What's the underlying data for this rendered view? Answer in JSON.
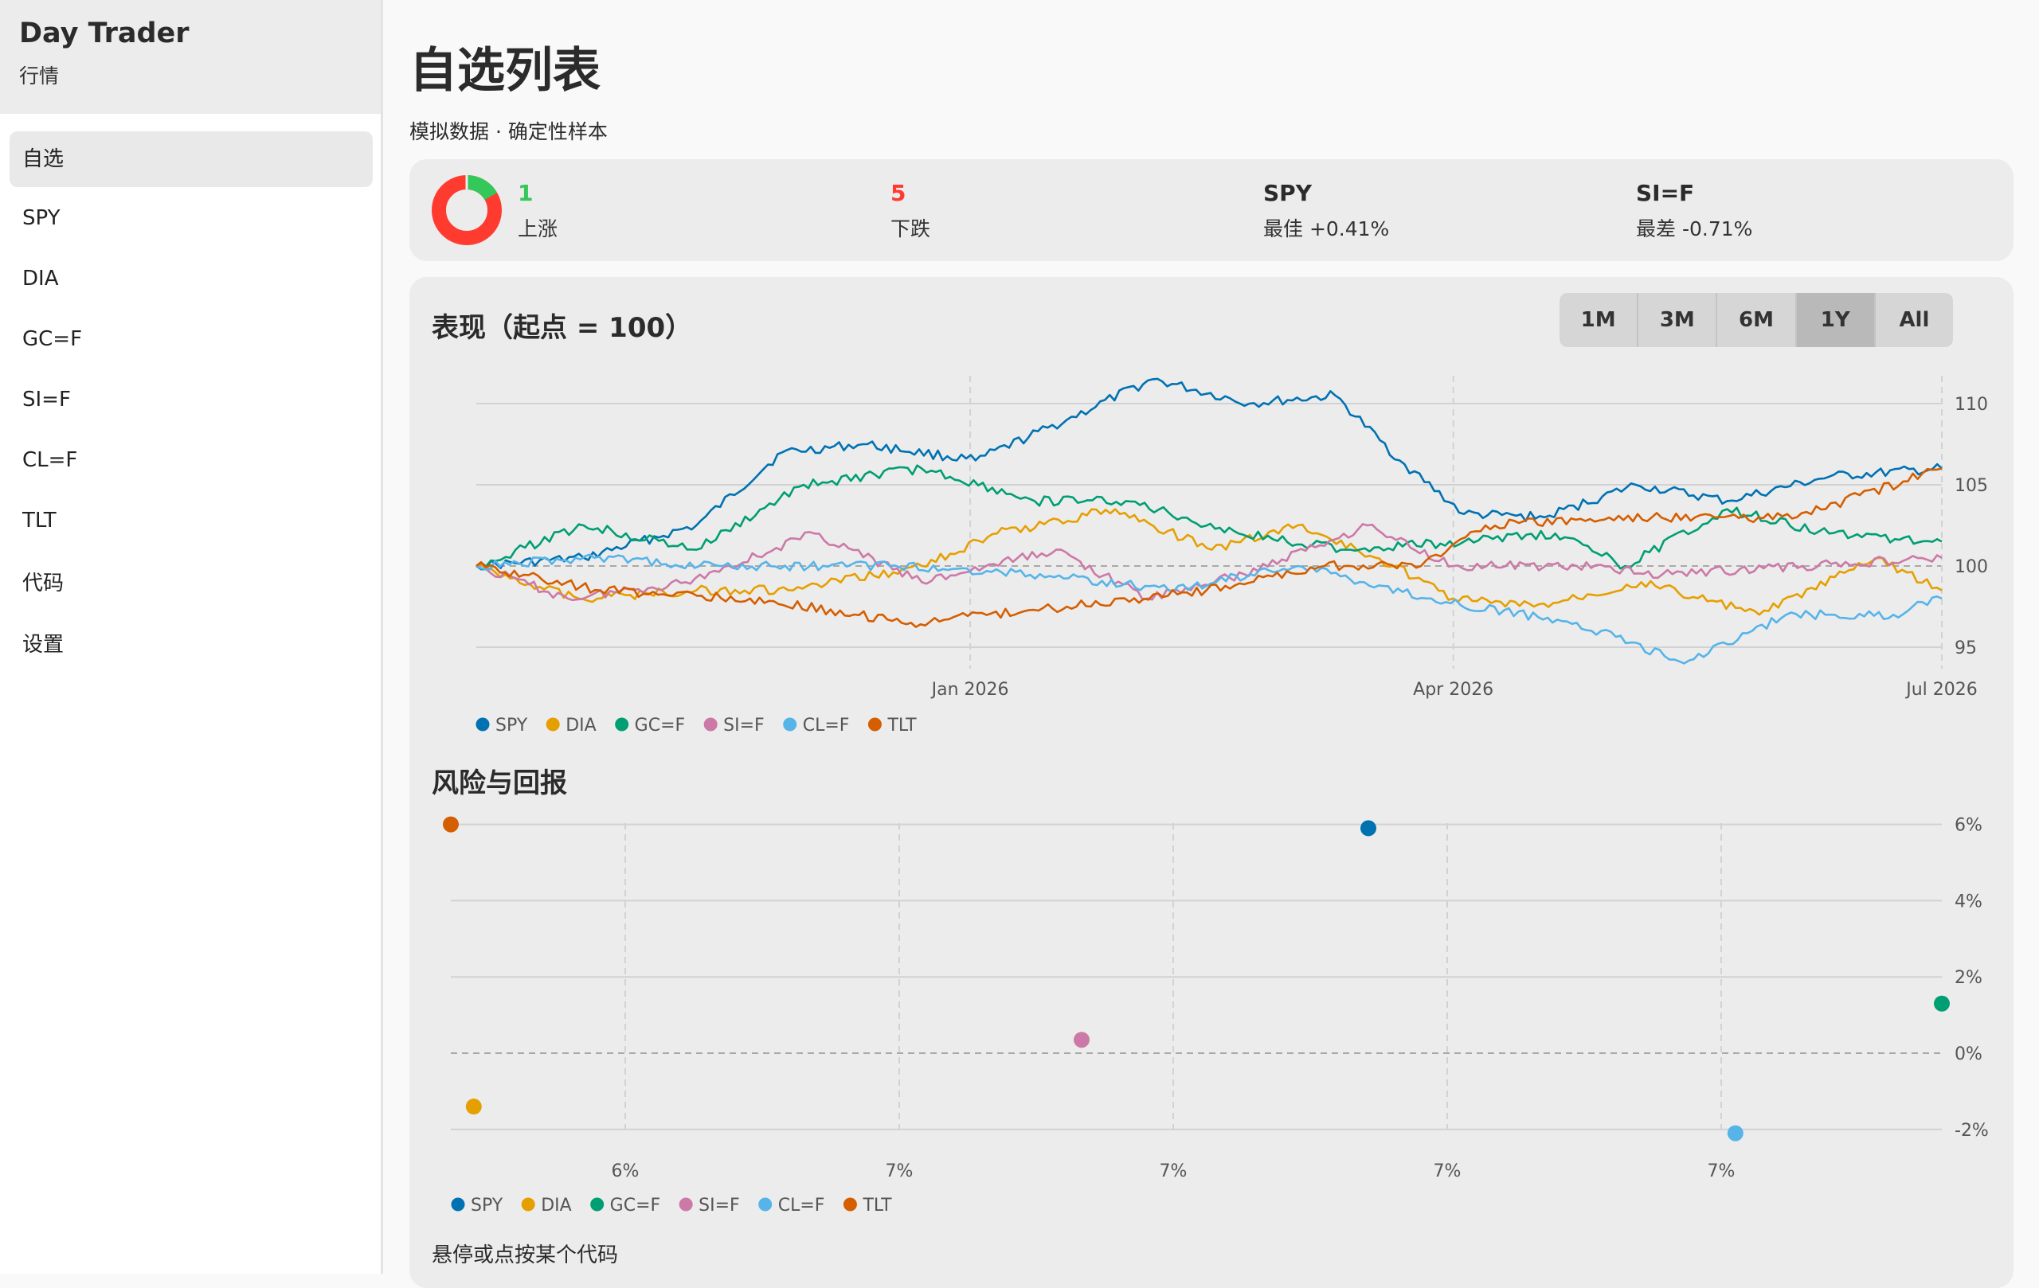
{
  "sidebar": {
    "app_title": "Day Trader",
    "subtitle": "行情",
    "items": [
      {
        "label": "自选",
        "active": true
      },
      {
        "label": "SPY"
      },
      {
        "label": "DIA"
      },
      {
        "label": "GC=F"
      },
      {
        "label": "SI=F"
      },
      {
        "label": "CL=F"
      },
      {
        "label": "TLT"
      },
      {
        "label": "代码"
      },
      {
        "label": "设置"
      }
    ]
  },
  "header": {
    "title": "自选列表",
    "subtitle": "模拟数据 · 确定性样本"
  },
  "summary": {
    "up_count": "1",
    "up_label": "上涨",
    "up_color": "#34c759",
    "down_count": "5",
    "down_label": "下跌",
    "down_color": "#ff3b30",
    "best_symbol": "SPY",
    "best_text": "最佳 +0.41%",
    "worst_symbol": "SI=F",
    "worst_text": "最差 -0.71%"
  },
  "performance": {
    "title": "表现（起点 = 100）",
    "ranges": [
      {
        "label": "1M"
      },
      {
        "label": "3M"
      },
      {
        "label": "6M"
      },
      {
        "label": "1Y",
        "active": true
      },
      {
        "label": "All"
      }
    ],
    "x_ticks": [
      "Jan 2026",
      "Apr 2026",
      "Jul 2026"
    ],
    "y_ticks": [
      "95",
      "100",
      "105",
      "110"
    ]
  },
  "risk": {
    "title": "风险与回报",
    "x_ticks": [
      "6%",
      "7%",
      "7%",
      "7%",
      "7%"
    ],
    "y_ticks": [
      "6%",
      "4%",
      "2%",
      "0%",
      "-2%"
    ]
  },
  "hint": "悬停或点按某个代码",
  "colors": {
    "SPY": "#0072b2",
    "DIA": "#e69f00",
    "GC=F": "#009e73",
    "SI=F": "#cc79a7",
    "CL=F": "#56b4e9",
    "TLT": "#d55e00"
  },
  "chart_data": [
    {
      "type": "line",
      "title": "表现（起点 = 100）",
      "x_range": [
        "2025-10-01",
        "2026-07-01"
      ],
      "ylim": [
        93,
        112
      ],
      "series": [
        {
          "name": "SPY",
          "points": [
            [
              "2025-10-01",
              100
            ],
            [
              "2025-10-21",
              100.5
            ],
            [
              "2025-11-11",
              102.5
            ],
            [
              "2025-11-27",
              107
            ],
            [
              "2025-12-12",
              107.5
            ],
            [
              "2026-01-02",
              106.5
            ],
            [
              "2026-01-19",
              109
            ],
            [
              "2026-02-04",
              111.5
            ],
            [
              "2026-02-22",
              110
            ],
            [
              "2026-03-10",
              110.5
            ],
            [
              "2026-03-22",
              106.5
            ],
            [
              "2026-04-03",
              103.2
            ],
            [
              "2026-04-18",
              103
            ],
            [
              "2026-05-05",
              105
            ],
            [
              "2026-05-22",
              104
            ],
            [
              "2026-06-10",
              105.5
            ],
            [
              "2026-07-01",
              106
            ]
          ]
        },
        {
          "name": "DIA",
          "points": [
            [
              "2025-10-01",
              100
            ],
            [
              "2025-10-20",
              98
            ],
            [
              "2025-11-11",
              98.5
            ],
            [
              "2025-11-29",
              98.5
            ],
            [
              "2025-12-23",
              100
            ],
            [
              "2026-01-06",
              102
            ],
            [
              "2026-01-28",
              103.5
            ],
            [
              "2026-02-15",
              101
            ],
            [
              "2026-03-03",
              102.5
            ],
            [
              "2026-03-21",
              100
            ],
            [
              "2026-04-01",
              98
            ],
            [
              "2026-04-16",
              97.5
            ],
            [
              "2026-05-06",
              99
            ],
            [
              "2026-05-28",
              97
            ],
            [
              "2026-06-19",
              100.5
            ],
            [
              "2026-07-01",
              98.5
            ]
          ]
        },
        {
          "name": "GC=F",
          "points": [
            [
              "2025-10-01",
              100
            ],
            [
              "2025-10-21",
              102.5
            ],
            [
              "2025-11-11",
              101
            ],
            [
              "2025-12-01",
              105
            ],
            [
              "2025-12-23",
              106
            ],
            [
              "2026-01-13",
              104
            ],
            [
              "2026-01-30",
              104
            ],
            [
              "2026-02-20",
              102
            ],
            [
              "2026-03-12",
              101
            ],
            [
              "2026-04-03",
              101.5
            ],
            [
              "2026-04-20",
              102
            ],
            [
              "2026-05-03",
              100
            ],
            [
              "2026-05-22",
              103.5
            ],
            [
              "2026-06-10",
              102
            ],
            [
              "2026-07-01",
              101.5
            ]
          ]
        },
        {
          "name": "SI=F",
          "points": [
            [
              "2025-10-01",
              100
            ],
            [
              "2025-10-18",
              98
            ],
            [
              "2025-11-09",
              99
            ],
            [
              "2025-12-03",
              102
            ],
            [
              "2025-12-23",
              99
            ],
            [
              "2026-01-17",
              101
            ],
            [
              "2026-02-03",
              98
            ],
            [
              "2026-02-21",
              99.5
            ],
            [
              "2026-03-16",
              102.5
            ],
            [
              "2026-04-01",
              100
            ],
            [
              "2026-04-24",
              100
            ],
            [
              "2026-05-10",
              99.5
            ],
            [
              "2026-06-05",
              100
            ],
            [
              "2026-07-01",
              100.5
            ]
          ]
        },
        {
          "name": "CL=F",
          "points": [
            [
              "2025-10-01",
              100
            ],
            [
              "2025-10-23",
              100.5
            ],
            [
              "2025-11-16",
              100
            ],
            [
              "2025-12-17",
              100
            ],
            [
              "2026-01-14",
              99.5
            ],
            [
              "2026-02-07",
              98.5
            ],
            [
              "2026-03-03",
              100
            ],
            [
              "2026-03-27",
              98
            ],
            [
              "2026-04-24",
              96.5
            ],
            [
              "2026-05-14",
              94
            ],
            [
              "2026-06-02",
              97
            ],
            [
              "2026-06-22",
              97
            ],
            [
              "2026-07-01",
              98
            ]
          ]
        },
        {
          "name": "TLT",
          "points": [
            [
              "2025-10-01",
              100
            ],
            [
              "2025-10-24",
              98.5
            ],
            [
              "2025-11-21",
              98
            ],
            [
              "2025-12-21",
              96.5
            ],
            [
              "2026-01-19",
              97.5
            ],
            [
              "2026-02-14",
              98.5
            ],
            [
              "2026-03-08",
              100
            ],
            [
              "2026-03-26",
              100
            ],
            [
              "2026-04-07",
              102.5
            ],
            [
              "2026-05-08",
              103
            ],
            [
              "2026-06-04",
              103
            ],
            [
              "2026-07-01",
              106
            ]
          ]
        }
      ]
    },
    {
      "type": "scatter",
      "title": "风险与回报",
      "x_tick_labels": [
        "6%",
        "7%",
        "7%",
        "7%",
        "7%"
      ],
      "ylim": [
        -2.6,
        6
      ],
      "points": [
        {
          "name": "TLT",
          "x": 6.1,
          "y": 6.0
        },
        {
          "name": "DIA",
          "x": 6.12,
          "y": -1.4
        },
        {
          "name": "SI=F",
          "x": 6.65,
          "y": 0.35
        },
        {
          "name": "SPY",
          "x": 6.9,
          "y": 5.9
        },
        {
          "name": "CL=F",
          "x": 7.22,
          "y": -2.1
        },
        {
          "name": "GC=F",
          "x": 7.4,
          "y": 1.3
        }
      ]
    }
  ]
}
